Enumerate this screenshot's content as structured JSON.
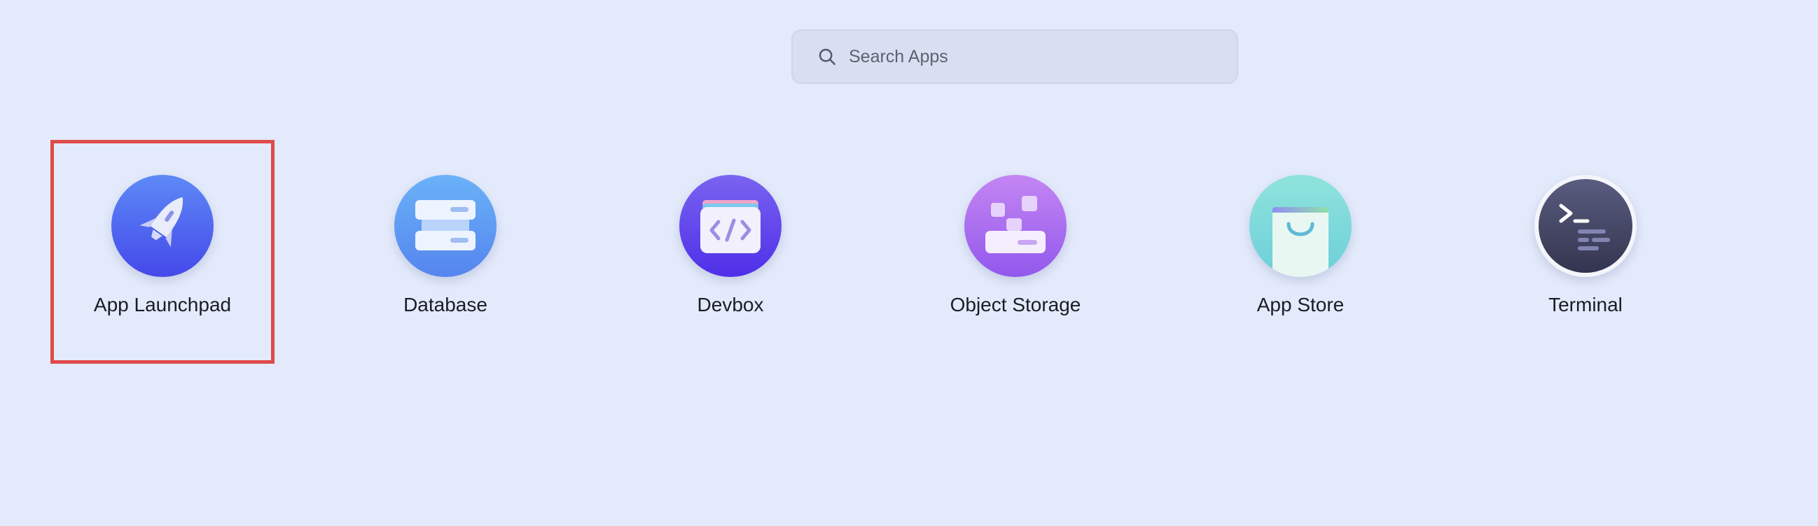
{
  "search": {
    "placeholder": "Search Apps",
    "value": ""
  },
  "apps": [
    {
      "label": "App Launchpad",
      "icon": "rocket-icon",
      "color": "#4f63f0"
    },
    {
      "label": "Database",
      "icon": "database-icon",
      "color": "#5b97f2"
    },
    {
      "label": "Devbox",
      "icon": "code-box-icon",
      "color": "#6345ee"
    },
    {
      "label": "Object Storage",
      "icon": "storage-blocks-icon",
      "color": "#a565ee"
    },
    {
      "label": "App Store",
      "icon": "shopping-bag-icon",
      "color": "#6fd3d6"
    },
    {
      "label": "Terminal",
      "icon": "terminal-icon",
      "color": "#3f4262"
    }
  ],
  "colors": {
    "background": "#e3eafb",
    "highlight_border": "#df4a4a"
  }
}
